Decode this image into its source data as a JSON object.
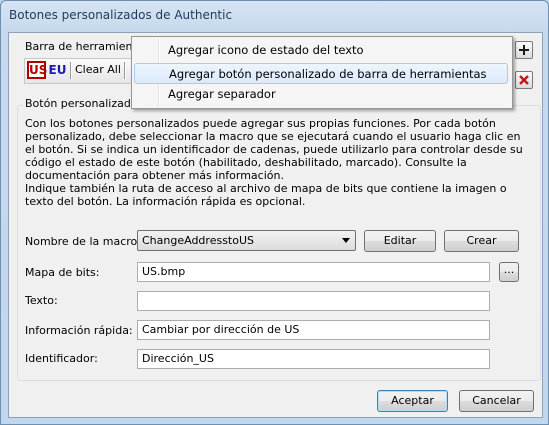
{
  "window": {
    "title": "Botones personalizados de Authentic"
  },
  "toolbar_group": {
    "label": "Barra de herramientas p",
    "us_label": "US",
    "eu_label": "EU",
    "clear_all": "Clear All",
    "add_icon": "plus-icon",
    "delete_icon": "red-x-icon"
  },
  "context_menu": {
    "items": [
      "Agregar icono de estado del texto",
      "Agregar botón personalizado de barra de herramientas",
      "Agregar separador"
    ],
    "highlighted_index": 1
  },
  "custom_button": {
    "label": "Botón personalizado",
    "description": [
      "Con los botones personalizados puede agregar sus propias funciones. Por cada botón personalizado, debe seleccionar la macro que se ejecutará cuando el usuario haga clic en el botón. Si se indica un identificador de cadenas, puede utilizarlo para controlar desde su código el estado de este botón (habilitado, deshabilitado, marcado). Consulte la documentación para obtener más información.",
      "Indique también la ruta de acceso al archivo de mapa de bits que contiene la imagen o texto del botón. La información rápida es opcional."
    ],
    "macro_label": "Nombre de la macro:",
    "macro_value": "ChangeAddresstoUS",
    "edit_button": "Editar",
    "create_button": "Crear",
    "bitmap_label": "Mapa de bits:",
    "bitmap_value": "US.bmp",
    "browse_button": "...",
    "text_label": "Texto:",
    "text_value": "",
    "tooltip_label": "Información rápida:",
    "tooltip_value": "Cambiar por dirección de US",
    "identifier_label": "Identificador:",
    "identifier_value": "Dirección_US"
  },
  "footer": {
    "ok_button": "Aceptar",
    "cancel_button": "Cancelar"
  }
}
